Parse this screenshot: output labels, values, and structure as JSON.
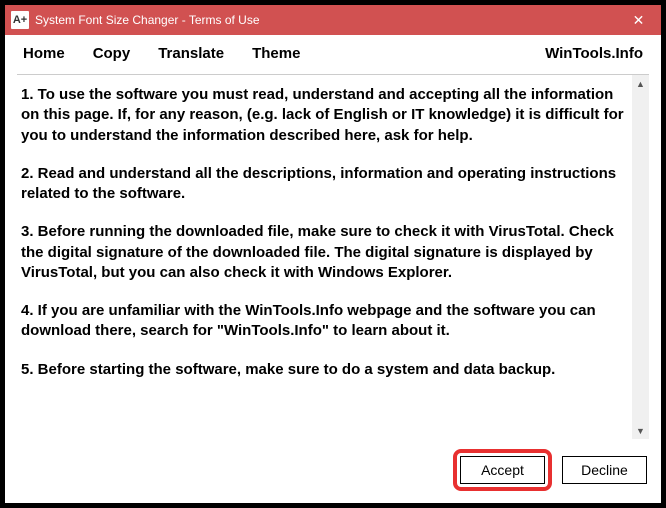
{
  "titlebar": {
    "icon_text": "A+",
    "title": "System Font Size Changer - Terms of Use",
    "close_glyph": "✕"
  },
  "menubar": {
    "home": "Home",
    "copy": "Copy",
    "translate": "Translate",
    "theme": "Theme",
    "right": "WinTools.Info"
  },
  "terms": {
    "p1": "1. To use the software you must read, understand and accepting all the information on this page. If, for any reason, (e.g. lack of English or IT knowledge) it is difficult for you to understand the information described here, ask for help.",
    "p2": "2. Read and understand all the descriptions, information and operating instructions related to the software.",
    "p3": "3. Before running the downloaded file, make sure to check it with VirusTotal. Check the digital signature of the downloaded file. The digital signature is displayed by VirusTotal, but you can also check it with Windows Explorer.",
    "p4": "4. If you are unfamiliar with the WinTools.Info webpage and the software you can download there, search for \"WinTools.Info\" to learn about it.",
    "p5": "5. Before starting the software, make sure to do a system and data backup."
  },
  "scrollbar": {
    "up_glyph": "▲",
    "down_glyph": "▼"
  },
  "buttons": {
    "accept": "Accept",
    "decline": "Decline"
  }
}
